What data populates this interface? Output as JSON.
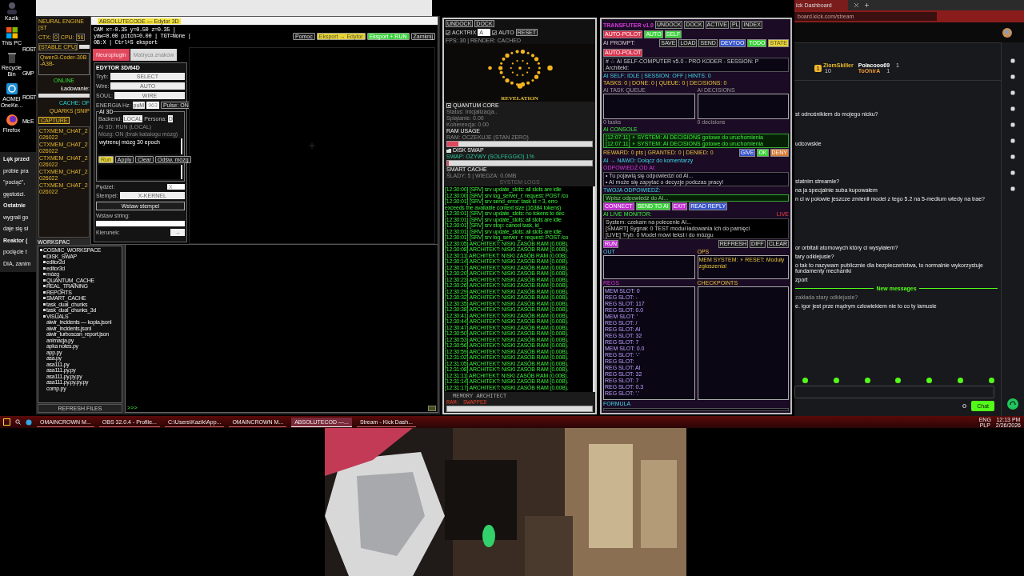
{
  "desktop": {
    "icons": [
      {
        "label": "Kazik",
        "kind": "user"
      },
      {
        "label": "This PC",
        "kind": "windows"
      },
      {
        "label": "Recycle Bin",
        "kind": "bin"
      },
      {
        "label": "AOMEI OneKe...",
        "kind": "aomei"
      },
      {
        "label": "Firefox",
        "kind": "firefox"
      }
    ],
    "icons_cut": [
      "ROST",
      "GMP",
      "ROST",
      "Mic E"
    ],
    "article_lines": [
      {
        "text": "Lęk przed",
        "bold": true
      },
      {
        "text": "próbie pra",
        "bold": false
      },
      {
        "text": "\"pociąć\",",
        "bold": false
      },
      {
        "text": "gęstości.",
        "bold": false
      },
      {
        "text": "Ostatnie",
        "bold": true
      },
      {
        "text": "wygrali go",
        "bold": false
      },
      {
        "text": "daje się sł",
        "bold": false
      },
      {
        "text": "Reaktor (",
        "bold": true
      },
      {
        "text": "pocięcie t",
        "bold": false
      },
      {
        "text": "DIA, zanim",
        "bold": false
      }
    ]
  },
  "workspace_app": {
    "title": "NEURAL ENGINE [ST",
    "ctx_label": "CTX:",
    "ctx": "0",
    "cpu_label": "CPU:",
    "cpu": "56",
    "stable": "[STABLE CPU]",
    "model": "Qwen3-Coder-30B-A3B-",
    "online": "ONLINE",
    "loading": "Ładowanie:",
    "cache": "CACHE: OF",
    "quarks": "QUARKS (SNIP",
    "capture": "CAPTURE",
    "memories": [
      "CTXMEM_CHAT_2026022",
      "CTXMEM_CHAT_2026022",
      "CTXMEM_CHAT_2026022",
      "CTXMEM_CHAT_2026022",
      "CTXMEM_CHAT_2026022"
    ],
    "workspace": "WORKSPAC",
    "tree": [
      {
        "label": "COSMIC_WORKSPACE",
        "kind": "folder",
        "children": [
          {
            "label": "DISK_SWAP",
            "kind": "folder"
          },
          {
            "label": "editor2d",
            "kind": "folder"
          },
          {
            "label": "editor3d",
            "kind": "folder"
          },
          {
            "label": "mózg",
            "kind": "folder"
          },
          {
            "label": "QUANTUM_CACHE",
            "kind": "folder"
          },
          {
            "label": "REAL_TRAINING",
            "kind": "folder"
          },
          {
            "label": "REPORTS",
            "kind": "folder"
          },
          {
            "label": "SMART_CACHE",
            "kind": "folder"
          },
          {
            "label": "task_dual_chunks",
            "kind": "folder"
          },
          {
            "label": "task_dual_chunks_3d",
            "kind": "folder"
          },
          {
            "label": "VISUALS",
            "kind": "folder"
          },
          {
            "label": "aiwir_incidents — kopia.jsonl",
            "kind": "file"
          },
          {
            "label": "aiwir_incidents.jsonl",
            "kind": "file"
          },
          {
            "label": "aiwir_turboscan_report.json",
            "kind": "file"
          },
          {
            "label": "animacja.py",
            "kind": "file"
          },
          {
            "label": "apka notes.py",
            "kind": "file"
          },
          {
            "label": "app.py",
            "kind": "file"
          },
          {
            "label": "asa.py",
            "kind": "file"
          },
          {
            "label": "asa111.py",
            "kind": "file"
          },
          {
            "label": "asa111.py.py",
            "kind": "file"
          },
          {
            "label": "asa111.py.py.py",
            "kind": "file"
          },
          {
            "label": "asa111.py.py.py.py",
            "kind": "file"
          },
          {
            "label": "comp.py",
            "kind": "file"
          }
        ]
      }
    ],
    "refresh": "REFRESH FILES",
    "prompt": ">>>"
  },
  "editor": {
    "title": "ABSOLUTECODE — Edytor 3D",
    "status": "CAM x=-0.35 y=0.50 z=0.35 | yaw=0.00 pitch=0.00 | TGT=None | 0B:X | Ctrl+S eksport",
    "buttons": [
      {
        "label": "Pomoc",
        "kind": "plain"
      },
      {
        "label": "Eksport → Edytor",
        "kind": "yellow"
      },
      {
        "label": "Eksport + RUN",
        "kind": "green"
      },
      {
        "label": "Zamknij",
        "kind": "plain"
      }
    ],
    "tabs": [
      {
        "label": "Neuroplugin",
        "selected": true
      },
      {
        "label": "Matryca znaków",
        "selected": false
      }
    ],
    "heading": "EDYTOR 3D/64D",
    "selects": [
      {
        "label": "Tryb:",
        "value": "SELECT"
      },
      {
        "label": "Wire:",
        "value": "AUTO"
      },
      {
        "label": "SOUL:",
        "value": "WIRE"
      }
    ],
    "energy": {
      "label": "ENERGIA Hz:",
      "preset": "puM",
      "value": "963",
      "pulse": "Pulse: ON"
    },
    "ai": {
      "legend": "AI 3D",
      "backend_label": "Backend:",
      "backend": "LOCAL",
      "persona_label": "Persona:",
      "persona": "D",
      "status": "AI 3D: RUN (LOCAL)",
      "note": "Mózg: ON (brak katalogu mózg)",
      "prompt": "wytrenuj mózg 30 epoch",
      "buttons": [
        {
          "label": "Run",
          "kind": "yellow"
        },
        {
          "label": "Apply",
          "kind": "plain"
        },
        {
          "label": "Clear",
          "kind": "plain"
        },
        {
          "label": "Odśw. mózg",
          "kind": "plain"
        }
      ]
    },
    "brush_label": "Pędzel:",
    "brush": "X",
    "stamp_label": "Stempel:",
    "stamp": "X-KERNEL",
    "insert_stamp": "Wstaw stempel",
    "string_label": "Wstaw string:",
    "direction_label": "Kierunek:",
    "direction": "→"
  },
  "quantum_panel": {
    "undock": "UNDOCK",
    "dock": "DOCK",
    "acktrix": {
      "label": "ACKTRIX",
      "checked": true
    },
    "select": "A",
    "auto": {
      "label": "AUTO",
      "checked": true
    },
    "reset": "RESET",
    "fps": "FPS: 30 | RENDER: CACHED",
    "caption": "REVELATION",
    "core_title": "QUANTUM CORE",
    "core_lines": [
      "Status: Inicjalizacja..",
      "Splątanie: 0.00",
      "Koherencja: 0.00"
    ],
    "ram_title": "RAM USAGE",
    "ram_text": "RAM: OCZEKUJE (STAN ZERO)",
    "ram": {
      "level": 0.08
    },
    "swap_title": "DISK SWAP",
    "swap_text": "SWAP: OŻYWY (SOLFEGGIO) 1%",
    "swap": {
      "level": 0.01
    },
    "cache_title": "SMART CACHE",
    "cache_text": "ŚLADY: 5 | WIEDZA: 0.0MB",
    "logs_title": "SYSTEM LOGS",
    "logs": [
      "[12:30:00] [SRV] srv update_slots: all slots are idle",
      "[12:30:00] [SRV] srv log_server_r: request: POST /co",
      "[12:30:01] [SRV] srv  send_error: task id = 3, erro",
      "exceeds the available context size (16384 tokens)",
      "[12:30:01] [SRV] srv update_slots: no tokens to dec",
      "[12:30:01] [SRV] srv update_slots: all slots are idle",
      "[12:30:01] [SRV] srv        stop: cancel task, id_",
      "[12:30:01] [SRV] srv update_slots: all slots are idle",
      "[12:30:01] [SRV] srv log_server_r: request: POST /co",
      "[12:30:05] ARCHITEKT: NISKI ZASÓB RAM (0.00B).",
      "[12:30:08] ARCHITEKT: NISKI ZASÓB RAM (0.00B).",
      "[12:30:11] ARCHITEKT: NISKI ZASÓB RAM (0.00B).",
      "[12:30:14] ARCHITEKT: NISKI ZASÓB RAM (0.00B).",
      "[12:30:17] ARCHITEKT: NISKI ZASÓB RAM (0.00B).",
      "[12:30:20] ARCHITEKT: NISKI ZASÓB RAM (0.00B).",
      "[12:30:23] ARCHITEKT: NISKI ZASÓB RAM (0.00B).",
      "[12:30:26] ARCHITEKT: NISKI ZASÓB RAM (0.00B).",
      "[12:30:29] ARCHITEKT: NISKI ZASÓB RAM (0.00B).",
      "[12:30:32] ARCHITEKT: NISKI ZASÓB RAM (0.00B).",
      "[12:30:35] ARCHITEKT: NISKI ZASÓB RAM (0.00B).",
      "[12:30:38] ARCHITEKT: NISKI ZASÓB RAM (0.00B).",
      "[12:30:41] ARCHITEKT: NISKI ZASÓB RAM (0.00B).",
      "[12:30:44] ARCHITEKT: NISKI ZASÓB RAM (0.00B).",
      "[12:30:47] ARCHITEKT: NISKI ZASÓB RAM (0.00B).",
      "[12:30:50] ARCHITEKT: NISKI ZASÓB RAM (0.00B).",
      "[12:30:53] ARCHITEKT: NISKI ZASÓB RAM (0.00B).",
      "[12:30:56] ARCHITEKT: NISKI ZASÓB RAM (0.00B).",
      "[12:30:59] ARCHITEKT: NISKI ZASÓB RAM (0.00B).",
      "[12:31:02] ARCHITEKT: NISKI ZASÓB RAM (0.00B).",
      "[12:31:05] ARCHITEKT: NISKI ZASÓB RAM (0.00B).",
      "[12:31:08] ARCHITEKT: NISKI ZASÓB RAM (0.00B).",
      "[12:31:11] ARCHITEKT: NISKI ZASÓB RAM (0.00B).",
      "[12:31:14] ARCHITEKT: NISKI ZASÓB RAM (0.00B).",
      "[12:31:17] ARCHITEKT: NISKI ZASÓB RAM (0.00B)."
    ],
    "memory_title": "MEMORY ARCHITECT",
    "memory_status": "RAM: SWAPPED"
  },
  "self_computer": {
    "title": "TRANSFUTER v1.0",
    "top_buttons": [
      {
        "label": "UNDOCK",
        "kind": "plain"
      },
      {
        "label": "DOCK",
        "kind": "plain"
      },
      {
        "label": "ACTIVE",
        "kind": "plain"
      },
      {
        "label": "PL",
        "kind": "plain"
      },
      {
        "label": "INDEX",
        "kind": "plain"
      },
      {
        "label": "AUTO-POLOT",
        "kind": "red"
      },
      {
        "label": "AUTO",
        "kind": "green"
      },
      {
        "label": "SELF",
        "kind": "green"
      }
    ],
    "prompt_label": "AI PROMPT:",
    "prompt_buttons": [
      {
        "label": "SAVE",
        "kind": "plain"
      },
      {
        "label": "LOAD",
        "kind": "plain"
      },
      {
        "label": "SEND",
        "kind": "plain"
      },
      {
        "label": "DEVTOO",
        "kind": "blue"
      },
      {
        "label": "TODO",
        "kind": "green"
      },
      {
        "label": "STATE",
        "kind": "yellow"
      },
      {
        "label": "AUTO-POLOT",
        "kind": "red"
      }
    ],
    "prompt_lines": [
      "# ☆ AI SELF-COMPUTER v5.0 - PRO KODER - SESSION: P",
      "Architekt:"
    ],
    "status": "AI SELF: IDLE | SESSION: OFF | HINTS: 0",
    "counters": "TASKS: 0 | DONE: 0 | QUEUE: 0 | DECISIONS: 0",
    "queue_title": "AI TASK QUEUE",
    "decisions_title": "AI DECISIONS",
    "queue_foot": "0 tasks",
    "decisions_foot": "0 decisions",
    "console_title": "AI CONSOLE",
    "console_lines": [
      "[12:07:11] ⚡ SYSTEM: AI DECISIONS gotowe do uruchomienia",
      "[12:07:11] ⚡ SYSTEM: AI DECISIONS gotowe do uruchomienia"
    ],
    "reward": "REWARD: 0 pts | GRANTED: 0 | DENIED: 0",
    "reward_buttons": [
      {
        "label": "GIVE",
        "kind": "blue"
      },
      {
        "label": "OK",
        "kind": "green"
      },
      {
        "label": "DENY",
        "kind": "orange"
      }
    ],
    "ai_line": "AI → NAWO: Dołącz do komentarzy",
    "feedback_title": "ODPOWIEDŹ OD AI:",
    "feedback_lines": [
      "• Tu pojawią się odpowiedzi od AI...",
      "• AI może się zapytać o decyzje podczas pracy!"
    ],
    "reply_title": "TWOJA ODPOWIEDŹ:",
    "reply_placeholder": "Wpisz odpowiedź do AI...",
    "action_buttons": [
      {
        "label": "CONNECT",
        "kind": "magenta"
      },
      {
        "label": "SEND TO AI",
        "kind": "green"
      },
      {
        "label": "EXIT",
        "kind": "magenta"
      },
      {
        "label": "READ REPLY",
        "kind": "blue"
      }
    ],
    "monitor_title": "AI LIVE MONITOR:",
    "monitor_flag": "LIVE",
    "monitor_lines": [
      "System: czekam na polecenie AI...",
      "[SMART] Sygnał: 0 TEST moduł ładowania ich do pamięci",
      "[LIVE] Tryb: 0 Model mówi tekst i do mózgu"
    ],
    "mid_left": "RUN",
    "mid_buttons": [
      "REFRESH",
      "DIFF",
      "CLEAR"
    ],
    "out_title": "OUT",
    "ops_title": "OPS",
    "ops_line": "MEM SYSTEM: ⚡ RESET: Moduły zgłoszenia!",
    "regs_title": "REGS",
    "regs": [
      "MEM SLOT: 0",
      "REG SLOT: -",
      "REG SLOT: 117",
      "REG SLOT: 0.0",
      "MEM SLOT: '",
      "REG SLOT: /",
      "REG SLOT: Al",
      "REG SLOT: 32",
      "REG SLOT: 7",
      "MEM SLOT: 0.0",
      "REG SLOT: '-'",
      "REG SLOT:",
      "REG SLOT: Al",
      "REG SLOT: 32",
      "REG SLOT: 7",
      "REG SLOT: 0.3",
      "REG SLOT: '.'"
    ],
    "checkpoints_title": "CHECKPOINTS",
    "formula_title": "FORMULA"
  },
  "chat": {
    "tab": "ick Dashboard",
    "address": "board.kick.com/stream",
    "leaders": [
      {
        "rank": "1",
        "name": "ZiomSkiller",
        "count": "10",
        "top": true
      },
      {
        "name": "Polacooo69",
        "count": "1",
        "top": false
      },
      {
        "name": "ToOhirA",
        "count": "1",
        "top": false
      }
    ],
    "messages": [
      {
        "text": "st odnośnikiem do mojego nicku?",
        "kind": "msg"
      },
      {
        "text": "udcowskie",
        "kind": "msg"
      },
      {
        "text": "statnim streamie?",
        "kind": "msg"
      },
      {
        "text": "na ja specjalnie suba kupowałem",
        "kind": "msg"
      },
      {
        "text": "n ci w połowie jeszcze zmienił model z tego 5.2 na 5-medium wtedy na trae?",
        "kind": "msg"
      },
      {
        "text": "or orbitali atomowych który ci wysyłałem?",
        "kind": "msg"
      },
      {
        "text": "tary odklejusie?",
        "kind": "msg"
      },
      {
        "text": "o tak to nazywam publicznie dla bezpieczeństwa, to normalnie wykorzystuje fundamenty mechaniki",
        "kind": "msg"
      },
      {
        "text": "zport",
        "kind": "msg"
      },
      {
        "text": "New messages",
        "kind": "divider"
      },
      {
        "text": "zakłada stary odklejusie?",
        "kind": "reply"
      },
      {
        "text": "e. igor jest prze mądrym człowiekiem nie to co ty lamusie",
        "kind": "msg"
      }
    ],
    "send": "Chat"
  },
  "taskbar": {
    "apps": [
      {
        "label": "OMAINCROWN M...",
        "active": false
      },
      {
        "label": "OBS 32.0.4 - Profile...",
        "active": false
      },
      {
        "label": "C:\\Users\\Kazik\\App...",
        "active": false
      },
      {
        "label": "OMAINCROWN M...",
        "active": false
      },
      {
        "label": "ABSOLUTECOD —...",
        "active": true
      },
      {
        "label": "Stream - Kick Dash...",
        "active": false
      }
    ],
    "lang": "ENG",
    "layout": "PLP",
    "time": "12:13 PM",
    "date": "2/26/2026"
  }
}
